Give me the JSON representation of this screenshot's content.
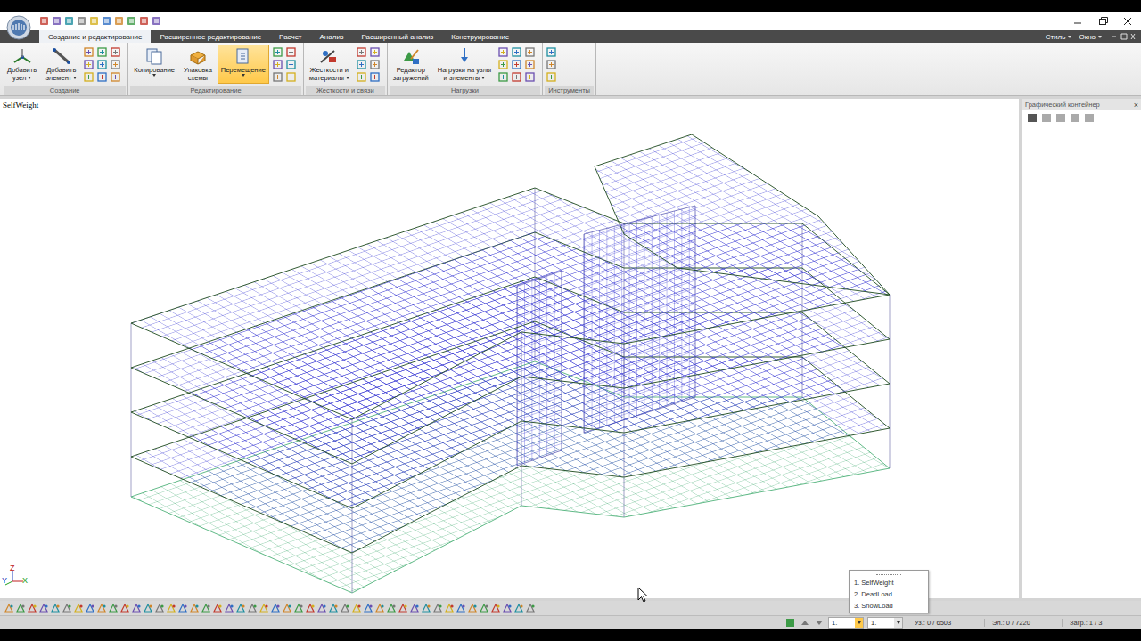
{
  "tabs": [
    {
      "label": "Создание и редактирование",
      "selected": true
    },
    {
      "label": "Расширенное редактирование",
      "selected": false
    },
    {
      "label": "Расчет",
      "selected": false
    },
    {
      "label": "Анализ",
      "selected": false
    },
    {
      "label": "Расширенный анализ",
      "selected": false
    },
    {
      "label": "Конструирование",
      "selected": false
    }
  ],
  "menu_right": [
    {
      "label": "Стиль",
      "has_menu": true
    },
    {
      "label": "Окно",
      "has_menu": true
    }
  ],
  "ribbon": {
    "groups": [
      {
        "label": "Создание",
        "buttons": [
          {
            "lines": [
              "Добавить",
              "узел"
            ],
            "has_menu": true,
            "selected": false
          },
          {
            "lines": [
              "Добавить",
              "элемент"
            ],
            "has_menu": true,
            "selected": false
          }
        ]
      },
      {
        "label": "Редактирование",
        "buttons": [
          {
            "lines": [
              "Копирование"
            ],
            "has_menu": true,
            "selected": false
          },
          {
            "lines": [
              "Упаковка",
              "схемы"
            ],
            "has_menu": false,
            "selected": false
          },
          {
            "lines": [
              "Перемещение"
            ],
            "has_menu": true,
            "selected": true
          }
        ]
      },
      {
        "label": "Жесткости и связи",
        "buttons": [
          {
            "lines": [
              "Жесткости и",
              "материалы"
            ],
            "has_menu": true,
            "selected": false
          }
        ]
      },
      {
        "label": "Нагрузки",
        "buttons": [
          {
            "lines": [
              "Редактор",
              "загружений"
            ],
            "has_menu": false,
            "selected": false
          },
          {
            "lines": [
              "Нагрузки на узлы",
              "и элементы"
            ],
            "has_menu": true,
            "selected": false
          }
        ]
      },
      {
        "label": "Инструменты",
        "buttons": []
      }
    ]
  },
  "viewport": {
    "load_case": "SelfWeight",
    "axes": [
      "Z",
      "Y",
      "X"
    ]
  },
  "side_panel": {
    "title": "Графический контейнер",
    "close": "×"
  },
  "load_case_menu": {
    "open": true,
    "items": [
      {
        "label": "1. SelfWeight",
        "selected": false
      },
      {
        "label": "2. DeadLoad",
        "selected": false
      },
      {
        "label": "3. SnowLoad",
        "selected": false
      }
    ]
  },
  "status_bar": {
    "combos": [
      "1.",
      "1."
    ],
    "nodes": "Уз.: 0 / 6503",
    "elements": "Эл.: 0 / 7220",
    "load_cases": "Загр.: 1 / 3"
  }
}
